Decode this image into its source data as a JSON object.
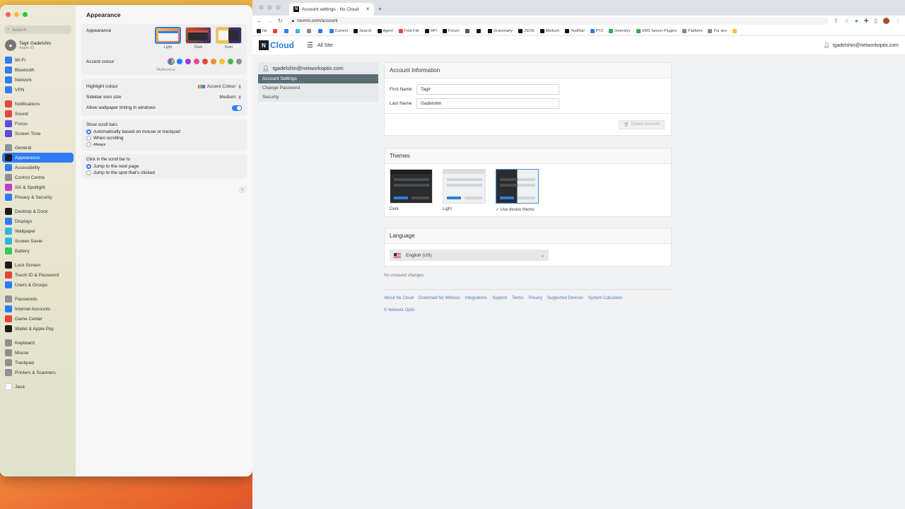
{
  "settings": {
    "search_placeholder": "Search",
    "user": {
      "name": "Tagir Gadelshin",
      "sub": "Apple ID"
    },
    "sidebar_groups": [
      [
        {
          "label": "Wi-Fi",
          "color": "#2f7cf6",
          "icon": "wifi-icon"
        },
        {
          "label": "Bluetooth",
          "color": "#2f7cf6",
          "icon": "bluetooth-icon"
        },
        {
          "label": "Network",
          "color": "#2f7cf6",
          "icon": "globe-icon"
        },
        {
          "label": "VPN",
          "color": "#2f7cf6",
          "icon": "vpn-icon"
        }
      ],
      [
        {
          "label": "Notifications",
          "color": "#e5453c",
          "icon": "bell-icon"
        },
        {
          "label": "Sound",
          "color": "#e5453c",
          "icon": "speaker-icon"
        },
        {
          "label": "Focus",
          "color": "#5b4fd6",
          "icon": "moon-icon"
        },
        {
          "label": "Screen Time",
          "color": "#5b4fd6",
          "icon": "hourglass-icon"
        }
      ],
      [
        {
          "label": "General",
          "color": "#8e8e93",
          "icon": "gear-icon"
        },
        {
          "label": "Appearance",
          "color": "#1c1c1e",
          "icon": "appearance-icon",
          "active": true
        },
        {
          "label": "Accessibility",
          "color": "#2f7cf6",
          "icon": "accessibility-icon"
        },
        {
          "label": "Control Centre",
          "color": "#8e8e93",
          "icon": "control-centre-icon"
        },
        {
          "label": "Siri & Spotlight",
          "color": "#c33ad0",
          "icon": "siri-icon"
        },
        {
          "label": "Privacy & Security",
          "color": "#2f7cf6",
          "icon": "hand-icon"
        }
      ],
      [
        {
          "label": "Desktop & Dock",
          "color": "#1c1c1e",
          "icon": "dock-icon"
        },
        {
          "label": "Displays",
          "color": "#2f7cf6",
          "icon": "display-icon"
        },
        {
          "label": "Wallpaper",
          "color": "#2fb5e8",
          "icon": "wallpaper-icon"
        },
        {
          "label": "Screen Saver",
          "color": "#2fb5e8",
          "icon": "screensaver-icon"
        },
        {
          "label": "Battery",
          "color": "#34c759",
          "icon": "battery-icon"
        }
      ],
      [
        {
          "label": "Lock Screen",
          "color": "#1c1c1e",
          "icon": "lock-icon"
        },
        {
          "label": "Touch ID & Password",
          "color": "#e5453c",
          "icon": "fingerprint-icon"
        },
        {
          "label": "Users & Groups",
          "color": "#2f7cf6",
          "icon": "users-icon"
        }
      ],
      [
        {
          "label": "Passwords",
          "color": "#8e8e93",
          "icon": "key-icon"
        },
        {
          "label": "Internet Accounts",
          "color": "#2f7cf6",
          "icon": "at-icon"
        },
        {
          "label": "Game Center",
          "color": "#e5453c",
          "icon": "game-icon"
        },
        {
          "label": "Wallet & Apple Pay",
          "color": "#1c1c1e",
          "icon": "wallet-icon"
        }
      ],
      [
        {
          "label": "Keyboard",
          "color": "#8e8e93",
          "icon": "keyboard-icon"
        },
        {
          "label": "Mouse",
          "color": "#8e8e93",
          "icon": "mouse-icon"
        },
        {
          "label": "Trackpad",
          "color": "#8e8e93",
          "icon": "trackpad-icon"
        },
        {
          "label": "Printers & Scanners",
          "color": "#8e8e93",
          "icon": "printer-icon"
        }
      ],
      [
        {
          "label": "Java",
          "color": "#ffffff",
          "icon": "java-icon"
        }
      ]
    ],
    "pane_title": "Appearance",
    "appearance_label": "Appearance",
    "appearance_options": [
      {
        "label": "Light",
        "selected": true
      },
      {
        "label": "Dark",
        "selected": false
      },
      {
        "label": "Auto",
        "selected": false
      }
    ],
    "accent_label": "Accent colour",
    "accent_caption": "Multicolour",
    "accent_colors": [
      "#8a4fe0",
      "#2f7cf6",
      "#9b3fd0",
      "#e0499c",
      "#e5453c",
      "#f0902f",
      "#f3c23a",
      "#4cb54c",
      "#8e8e93"
    ],
    "highlight_label": "Highlight colour",
    "highlight_value": "Accent Colour",
    "sidebar_icon_label": "Sidebar icon size",
    "sidebar_icon_value": "Medium",
    "wallpaper_tint_label": "Allow wallpaper tinting in windows",
    "scroll_bars_label": "Show scroll bars",
    "scroll_bars_options": [
      "Automatically based on mouse or trackpad",
      "When scrolling",
      "Always"
    ],
    "click_label": "Click in the scroll bar to",
    "click_options": [
      "Jump to the next page",
      "Jump to the spot that's clicked"
    ]
  },
  "browser": {
    "tab_title": "Account settings - Nx Cloud",
    "url": "nxvms.com/account",
    "bookmarks": [
      {
        "label": "Nx",
        "color": "#222"
      },
      {
        "label": "",
        "color": "#e5453c"
      },
      {
        "label": "",
        "color": "#2f7cf6"
      },
      {
        "label": "",
        "color": "#2fb5e8"
      },
      {
        "label": "",
        "color": "#888"
      },
      {
        "label": "",
        "color": "#2f7cf6"
      },
      {
        "label": "Current",
        "color": "#2f7cf6"
      },
      {
        "label": "Search",
        "color": "#111"
      },
      {
        "label": "Agent",
        "color": "#111"
      },
      {
        "label": "Find File",
        "color": "#e5453c"
      },
      {
        "label": "API",
        "color": "#111"
      },
      {
        "label": "Forum",
        "color": "#111"
      },
      {
        "label": "",
        "color": "#555"
      },
      {
        "label": "",
        "color": "#111"
      },
      {
        "label": "Grammarly",
        "color": "#111"
      },
      {
        "label": "JSON",
        "color": "#111"
      },
      {
        "label": "Medium",
        "color": "#111"
      },
      {
        "label": "TestRail",
        "color": "#111"
      },
      {
        "label": "PTZ",
        "color": "#2f7cf6"
      },
      {
        "label": "Inventory",
        "color": "#34a853"
      },
      {
        "label": "VMS Server Plugins",
        "color": "#34a853"
      },
      {
        "label": "Platform",
        "color": "#888"
      },
      {
        "label": "For dev",
        "color": "#888"
      },
      {
        "label": "",
        "color": "#f3c23a"
      }
    ],
    "app": {
      "logo_box": "N",
      "logo_text": "Cloud",
      "site": "All Site",
      "user_email": "tgadelshin@networkoptix.com"
    },
    "nav": {
      "email": "tgadelshin@networkoptix.com",
      "items": [
        {
          "label": "Account Settings",
          "active": true
        },
        {
          "label": "Change Password"
        },
        {
          "label": "Security"
        }
      ]
    },
    "account": {
      "title": "Account Information",
      "first_name_label": "First Name",
      "first_name": "Tagir",
      "last_name_label": "Last Name",
      "last_name": "Gadelshin",
      "delete_label": "Delete Account"
    },
    "themes": {
      "title": "Themes",
      "options": [
        {
          "label": "Dark",
          "selected": false
        },
        {
          "label": "Light",
          "selected": false
        },
        {
          "label": "Use device theme",
          "selected": true
        }
      ]
    },
    "language": {
      "title": "Language",
      "value": "English (US)"
    },
    "unsaved": "No unsaved changes",
    "footer_links": [
      "About Nx Cloud",
      "Download Nx Witness",
      "Integrations",
      "Support",
      "Terms",
      "Privacy",
      "Supported Devices",
      "System Calculator"
    ],
    "copyright": "© Network Optix"
  }
}
